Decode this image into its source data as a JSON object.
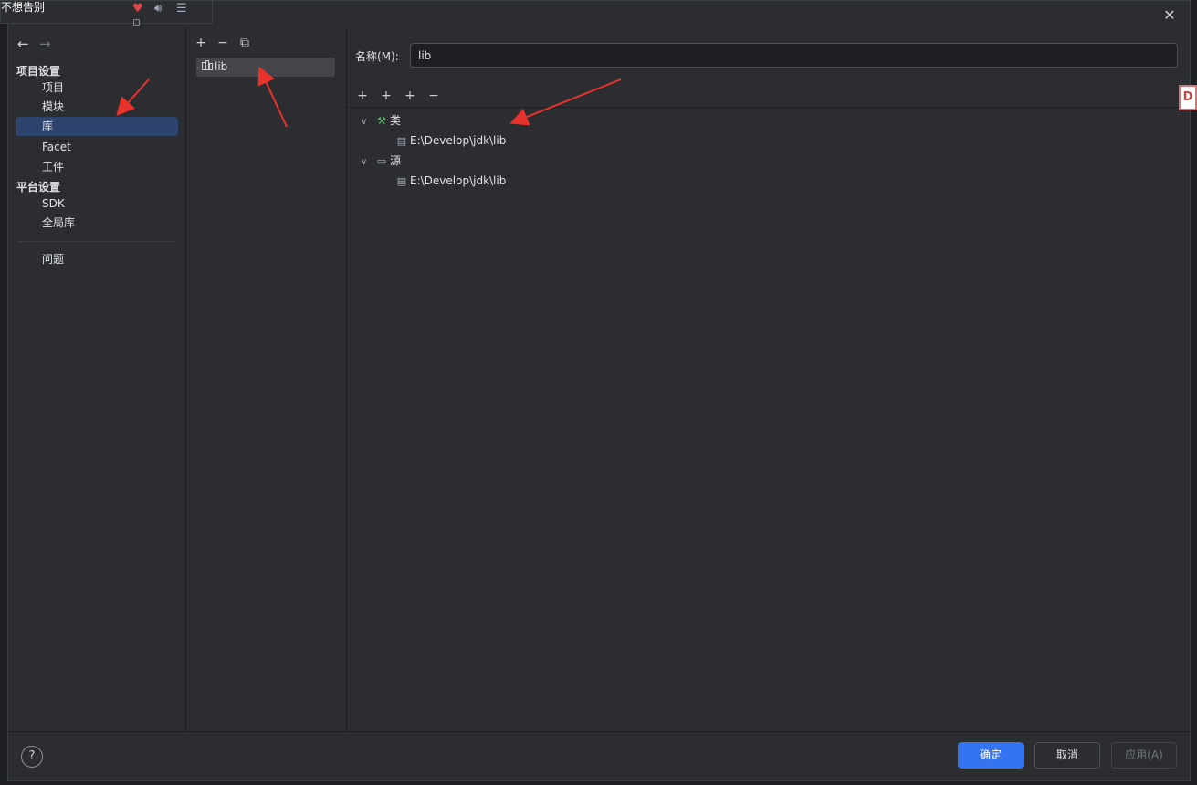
{
  "music": {
    "title": "不想告别",
    "icons": [
      "heart-icon",
      "volume-icon",
      "playlist-icon",
      "mini-icon"
    ]
  },
  "dialog": {
    "close_glyph": "✕"
  },
  "left_nav": {
    "back_glyph": "←",
    "forward_glyph": "→",
    "project_section": "项目设置",
    "project_items": [
      "项目",
      "模块",
      "库",
      "Facet",
      "工件"
    ],
    "platform_section": "平台设置",
    "platform_items": [
      "SDK",
      "全局库"
    ],
    "problems": "问题",
    "selected": "库"
  },
  "mid": {
    "toolbar": {
      "add": "+",
      "remove": "−",
      "copy": "⧉"
    },
    "library_name": "lib"
  },
  "detail": {
    "name_label": "名称(M):",
    "name_value": "lib",
    "toolbar": {
      "add": "+",
      "add_special": "+",
      "add_other": "+",
      "remove": "−"
    },
    "tree": {
      "classes": {
        "label": "类",
        "path": "E:\\Develop\\jdk\\lib"
      },
      "sources": {
        "label": "源",
        "path": "E:\\Develop\\jdk\\lib"
      }
    }
  },
  "footer": {
    "help": "?",
    "ok": "确定",
    "cancel": "取消",
    "apply": "应用(A)"
  },
  "colors": {
    "accent": "#3574f0",
    "selection": "#2e436e",
    "annotation": "#e8322b"
  }
}
